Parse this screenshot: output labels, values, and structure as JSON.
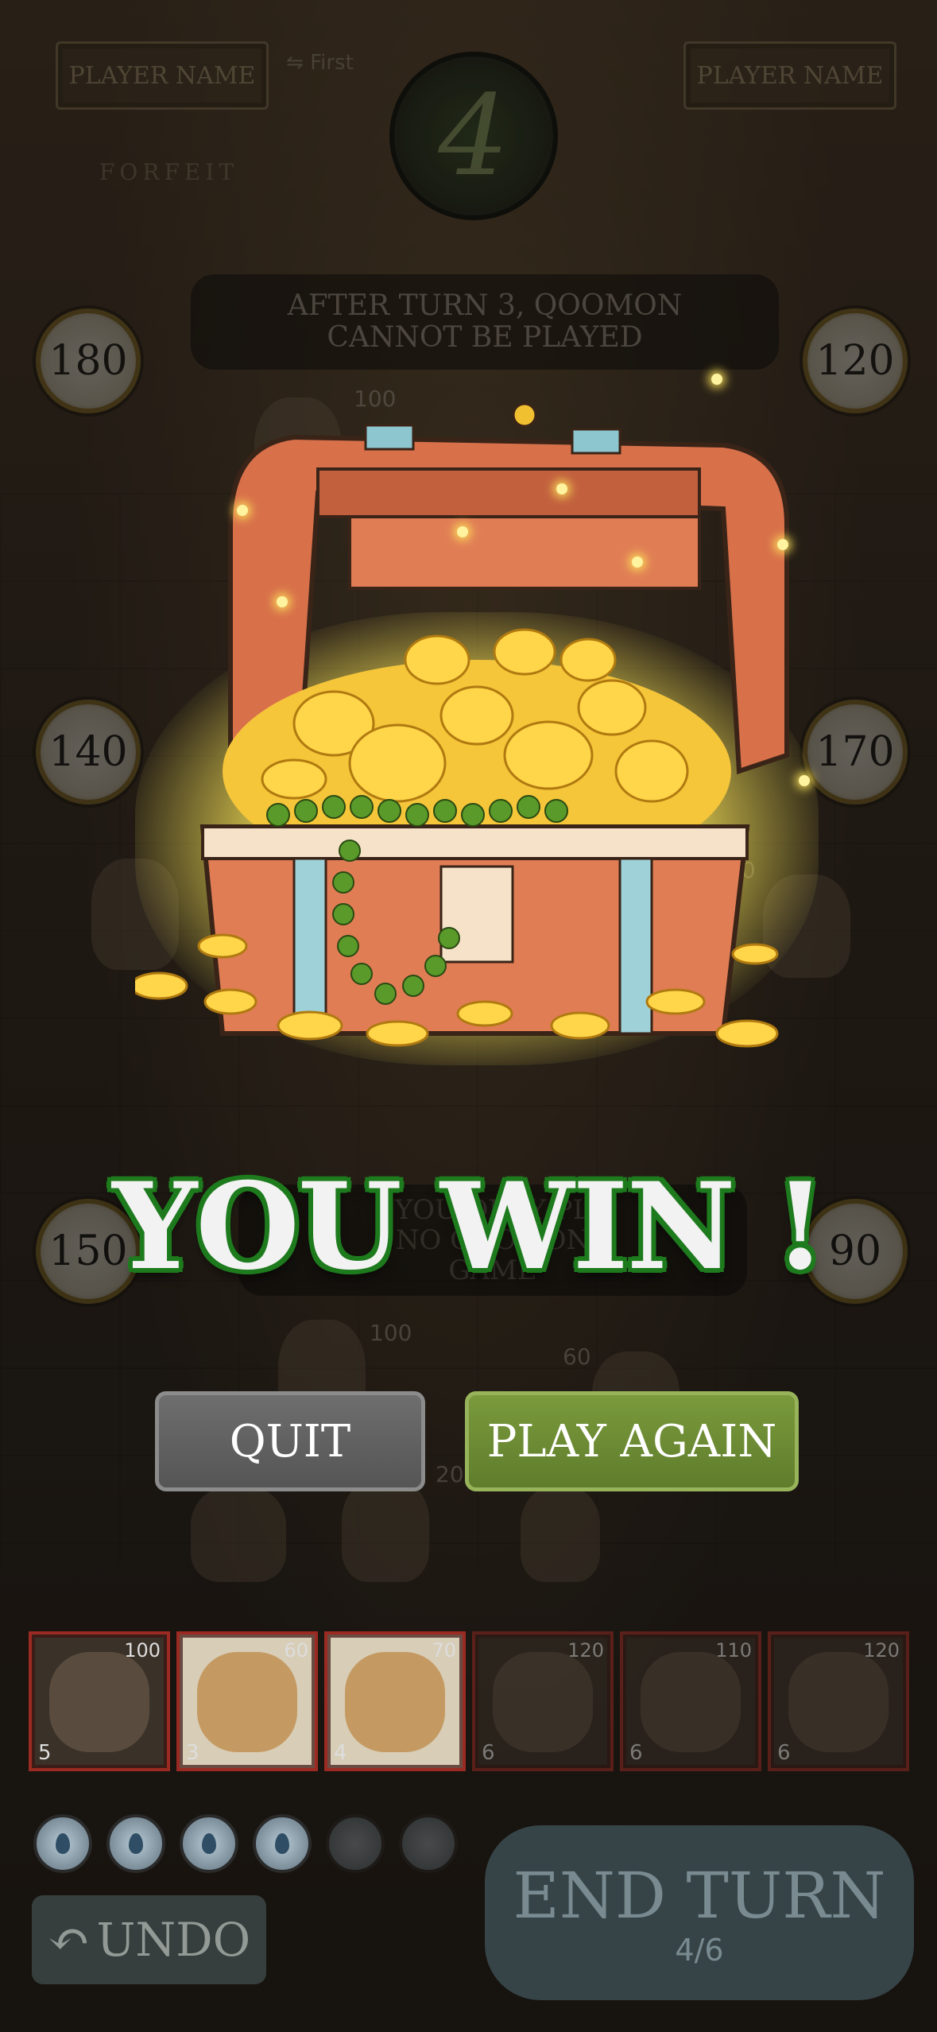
{
  "top": {
    "player_left": "PLAYER NAME",
    "player_right": "PLAYER NAME",
    "first_label": "First",
    "turn_number": "4",
    "forfeit": "FORFEIT"
  },
  "rule_top": [
    "AFTER TURN 3, QOOMON",
    "CANNOT BE PLAYED"
  ],
  "rule_mid": [
    "YOU ONLY PL",
    "NO QOOMON",
    "GAME"
  ],
  "scores": {
    "left": [
      "180",
      "140",
      "150"
    ],
    "right": [
      "120",
      "170",
      "90"
    ]
  },
  "board_numbers": [
    "100",
    "30",
    "100",
    "60",
    "20"
  ],
  "result": {
    "title": "YOU WIN !",
    "quit_label": "QUIT",
    "play_again_label": "PLAY AGAIN"
  },
  "hand": [
    {
      "power": "100",
      "cost": "5"
    },
    {
      "power": "60",
      "cost": "3"
    },
    {
      "power": "70",
      "cost": "4"
    },
    {
      "power": "120",
      "cost": "6"
    },
    {
      "power": "110",
      "cost": "6"
    },
    {
      "power": "120",
      "cost": "6"
    }
  ],
  "energy": {
    "total": 6,
    "available": 4
  },
  "controls": {
    "undo_label": "UNDO",
    "end_turn_label": "END TURN",
    "turn_progress": "4/6"
  },
  "colors": {
    "win_outline": "#1d7a1d",
    "play_again": "#6d8c34",
    "quit": "#616161",
    "card_border": "#9a2a22"
  }
}
